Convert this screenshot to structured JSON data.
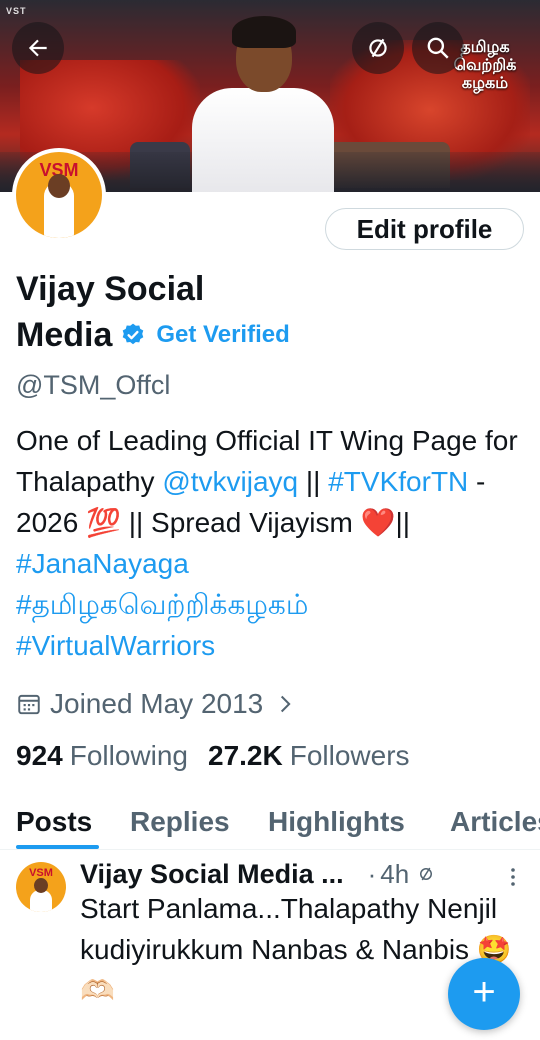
{
  "banner": {
    "watermark": "VST",
    "overlay_text": "தமிழக வெற்றிக் கழகம்"
  },
  "header": {
    "back_icon": "arrow-left-icon",
    "mute_icon": "mute-circle-icon",
    "search_icon": "search-icon"
  },
  "profile": {
    "avatar_text": "VSM",
    "edit_profile_label": "Edit profile",
    "name_line1": "Vijay Social",
    "name_line2": "Media",
    "get_verified_label": "Get Verified",
    "handle": "@TSM_Offcl",
    "bio": {
      "p1": "One of Leading Official IT Wing Page for Thalapathy ",
      "mention": "@tvkvijayq",
      "p2": " || ",
      "tag1": "#TVKforTN",
      "p3": " - 2026 💯 || Spread Vijayism ❤️|| ",
      "tag2": "#JanaNayaga",
      "tag3": "#தமிழகவெற்றிக்கழகம்",
      "tag4": "#VirtualWarriors"
    },
    "joined": "Joined May 2013",
    "following_count": "924",
    "following_label": "Following",
    "followers_count": "27.2K",
    "followers_label": "Followers"
  },
  "tabs": [
    "Posts",
    "Replies",
    "Highlights",
    "Articles"
  ],
  "post": {
    "author": "Vijay Social Media ...",
    "dot": "·",
    "time": "4h",
    "text": "Start Panlama...Thalapathy Nenjil kudiyirukkum Nanbas & Nanbis 🤩🫶🏻"
  },
  "fab": {
    "label": "+"
  },
  "colors": {
    "accent": "#1d9bf0",
    "text": "#0f1419",
    "muted": "#536471"
  }
}
